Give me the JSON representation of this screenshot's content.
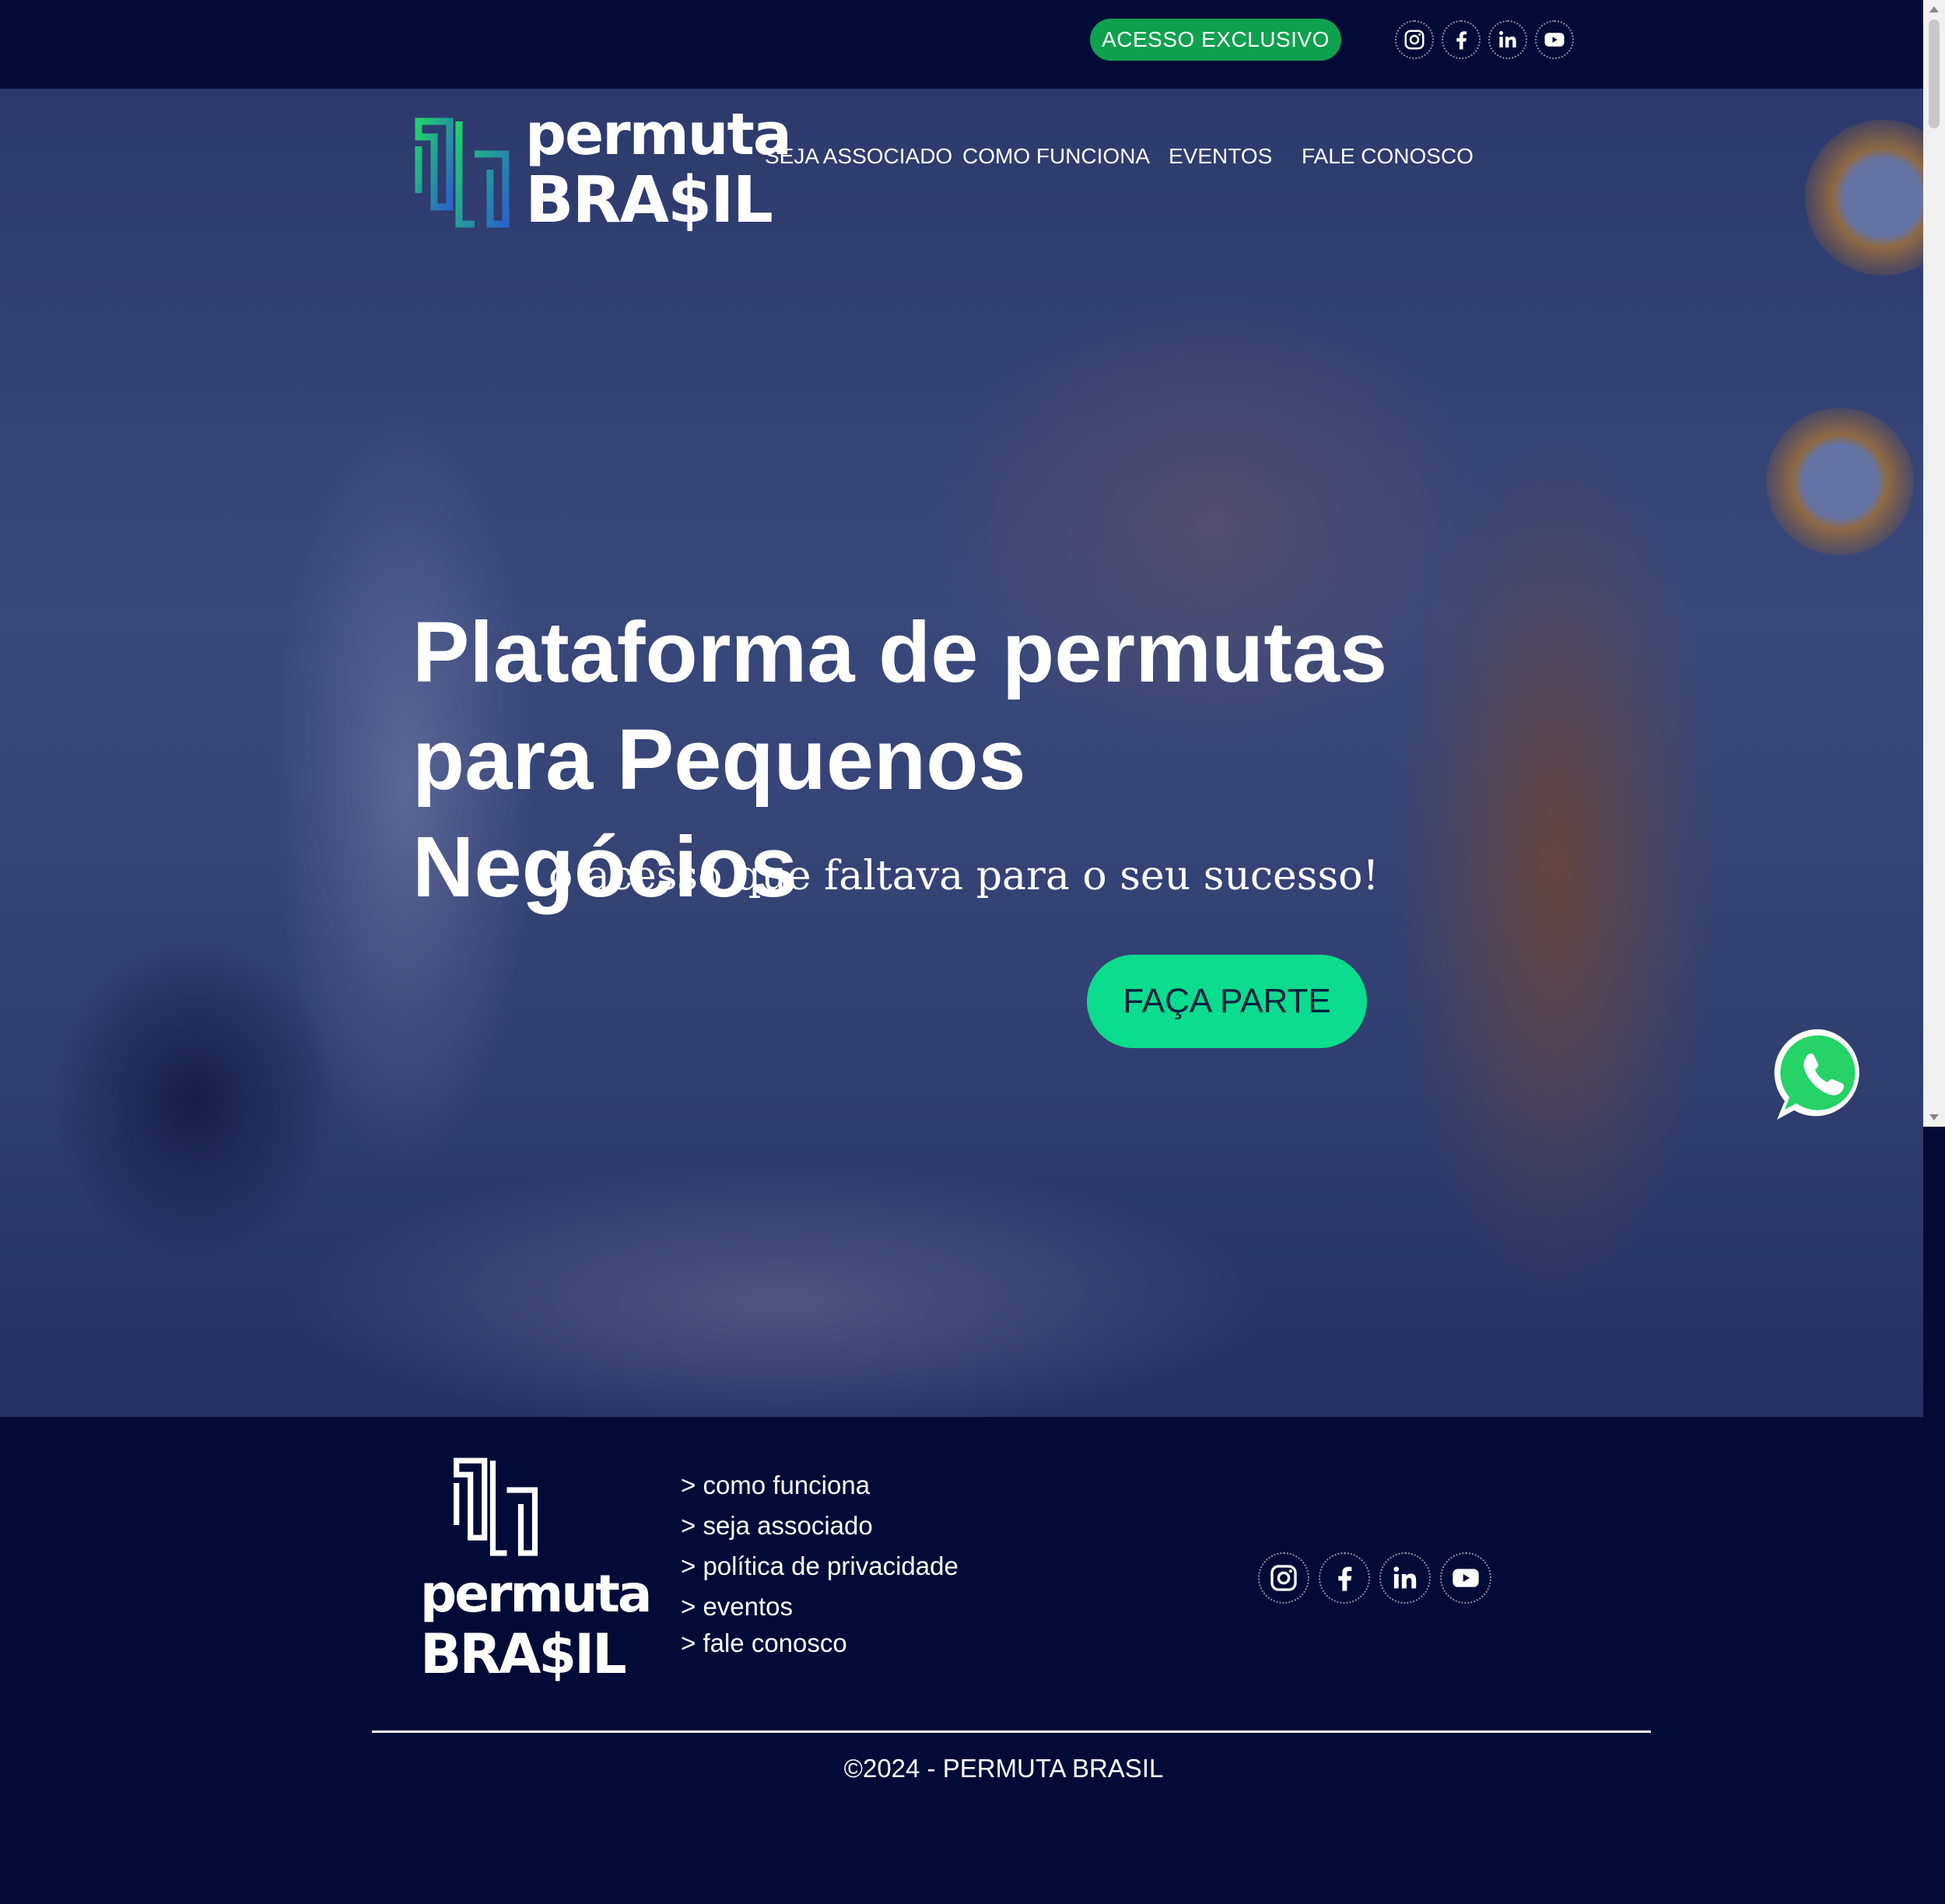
{
  "topbar": {
    "exclusive_button": "ACESSO EXCLUSIVO",
    "social": [
      "instagram-icon",
      "facebook-icon",
      "linkedin-icon",
      "youtube-icon"
    ]
  },
  "brand": {
    "line1": "permuta",
    "line2": "BRA$IL"
  },
  "nav": {
    "items": [
      "SEJA ASSOCIADO",
      "COMO FUNCIONA",
      "EVENTOS",
      "FALE CONOSCO"
    ]
  },
  "hero": {
    "headline_line1": "Plataforma de permutas",
    "headline_line2": "para Pequenos Negócios",
    "subheadline": "o acesso que faltava para o seu sucesso!",
    "cta_label": "FAÇA PARTE"
  },
  "footer": {
    "links": [
      "> como funciona",
      "> seja associado",
      "> política de privacidade",
      "> eventos",
      "> fale conosco"
    ],
    "copyright": "©2024 - PERMUTA BRASIL"
  },
  "colors": {
    "background": "#020b37",
    "exclusive_button": "#0fa14e",
    "cta_button": "#0bdc8d",
    "logo_gradient_start": "#1fd36b",
    "logo_gradient_end": "#2a62c9",
    "whatsapp": "#25d366"
  }
}
